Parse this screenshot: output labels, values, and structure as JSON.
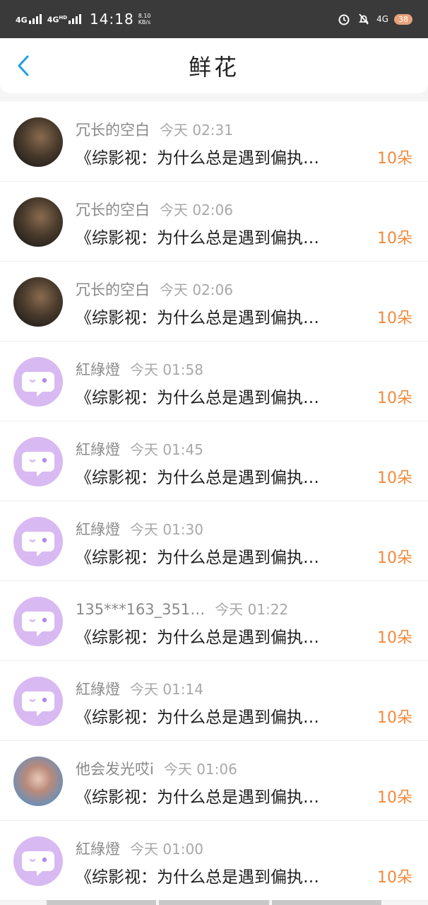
{
  "status_bar": {
    "sim1": "4G",
    "sim2": "4G",
    "sim2_sup": "HD",
    "time": "14:18",
    "speed_value": "8.10",
    "speed_unit": "KB/s",
    "network_right": "4G",
    "battery": "38"
  },
  "header": {
    "title": "鲜花"
  },
  "items": [
    {
      "nickname": "冗长的空白",
      "time": "今天 02:31",
      "content": "《综影视：为什么总是遇到偏执…",
      "count": "10朵",
      "avatar": "photo"
    },
    {
      "nickname": "冗长的空白",
      "time": "今天 02:06",
      "content": "《综影视：为什么总是遇到偏执…",
      "count": "10朵",
      "avatar": "photo"
    },
    {
      "nickname": "冗长的空白",
      "time": "今天 02:06",
      "content": "《综影视：为什么总是遇到偏执…",
      "count": "10朵",
      "avatar": "photo"
    },
    {
      "nickname": "紅綠燈",
      "time": "今天 01:58",
      "content": "《综影视：为什么总是遇到偏执…",
      "count": "10朵",
      "avatar": "default"
    },
    {
      "nickname": "紅綠燈",
      "time": "今天 01:45",
      "content": "《综影视：为什么总是遇到偏执…",
      "count": "10朵",
      "avatar": "default"
    },
    {
      "nickname": "紅綠燈",
      "time": "今天 01:30",
      "content": "《综影视：为什么总是遇到偏执…",
      "count": "10朵",
      "avatar": "default"
    },
    {
      "nickname": "135***163_351…",
      "time": "今天 01:22",
      "content": "《综影视：为什么总是遇到偏执…",
      "count": "10朵",
      "avatar": "default"
    },
    {
      "nickname": "紅綠燈",
      "time": "今天 01:14",
      "content": "《综影视：为什么总是遇到偏执…",
      "count": "10朵",
      "avatar": "default"
    },
    {
      "nickname": "他会发光哎i",
      "time": "今天 01:06",
      "content": "《综影视：为什么总是遇到偏执…",
      "count": "10朵",
      "avatar": "photo2"
    },
    {
      "nickname": "紅綠燈",
      "time": "今天 01:00",
      "content": "《综影视：为什么总是遇到偏执…",
      "count": "10朵",
      "avatar": "default"
    }
  ],
  "colors": {
    "accent": "#1e9fe6",
    "count": "#f08a3c",
    "status_bar": "#3a3a3a",
    "default_avatar": "#d9b9f2"
  },
  "icons": {
    "back": "chevron-left-icon",
    "alarm": "alarm-icon",
    "mute": "bell-off-icon",
    "default_avatar": "chat-bubble-icon"
  }
}
